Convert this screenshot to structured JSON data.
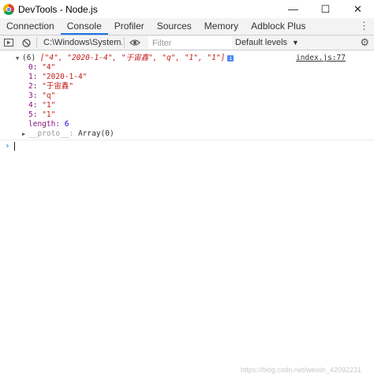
{
  "window": {
    "title": "DevTools - Node.js",
    "controls": [
      "—",
      "☐",
      "✕"
    ]
  },
  "tabs": [
    {
      "label": "Connection"
    },
    {
      "label": "Console"
    },
    {
      "label": "Profiler"
    },
    {
      "label": "Sources"
    },
    {
      "label": "Memory"
    },
    {
      "label": "Adblock Plus"
    }
  ],
  "toolbar": {
    "context": "C:\\Windows\\System...",
    "filter_placeholder": "Filter",
    "levels": "Default levels"
  },
  "console": {
    "summary_prefix": "(6)",
    "summary_items": "[\"4\", \"2020-1-4\", \"于宙鑫\", \"q\", \"1\", \"1\"]",
    "source": "index.js:77",
    "entries": [
      {
        "index": "0:",
        "value": "\"4\""
      },
      {
        "index": "1:",
        "value": "\"2020-1-4\""
      },
      {
        "index": "2:",
        "value": "\"于宙鑫\""
      },
      {
        "index": "3:",
        "value": "\"q\""
      },
      {
        "index": "4:",
        "value": "\"1\""
      },
      {
        "index": "5:",
        "value": "\"1\""
      }
    ],
    "length_label": "length:",
    "length_value": "6",
    "proto_label": "__proto__:",
    "proto_value": "Array(0)",
    "prompt": "›"
  },
  "watermark": "https://blog.csdn.net/weixin_42092231",
  "colors": {
    "active_tab": "#1a73e8",
    "string": "#c41a16",
    "index": "#881280",
    "number": "#1c00cf"
  }
}
